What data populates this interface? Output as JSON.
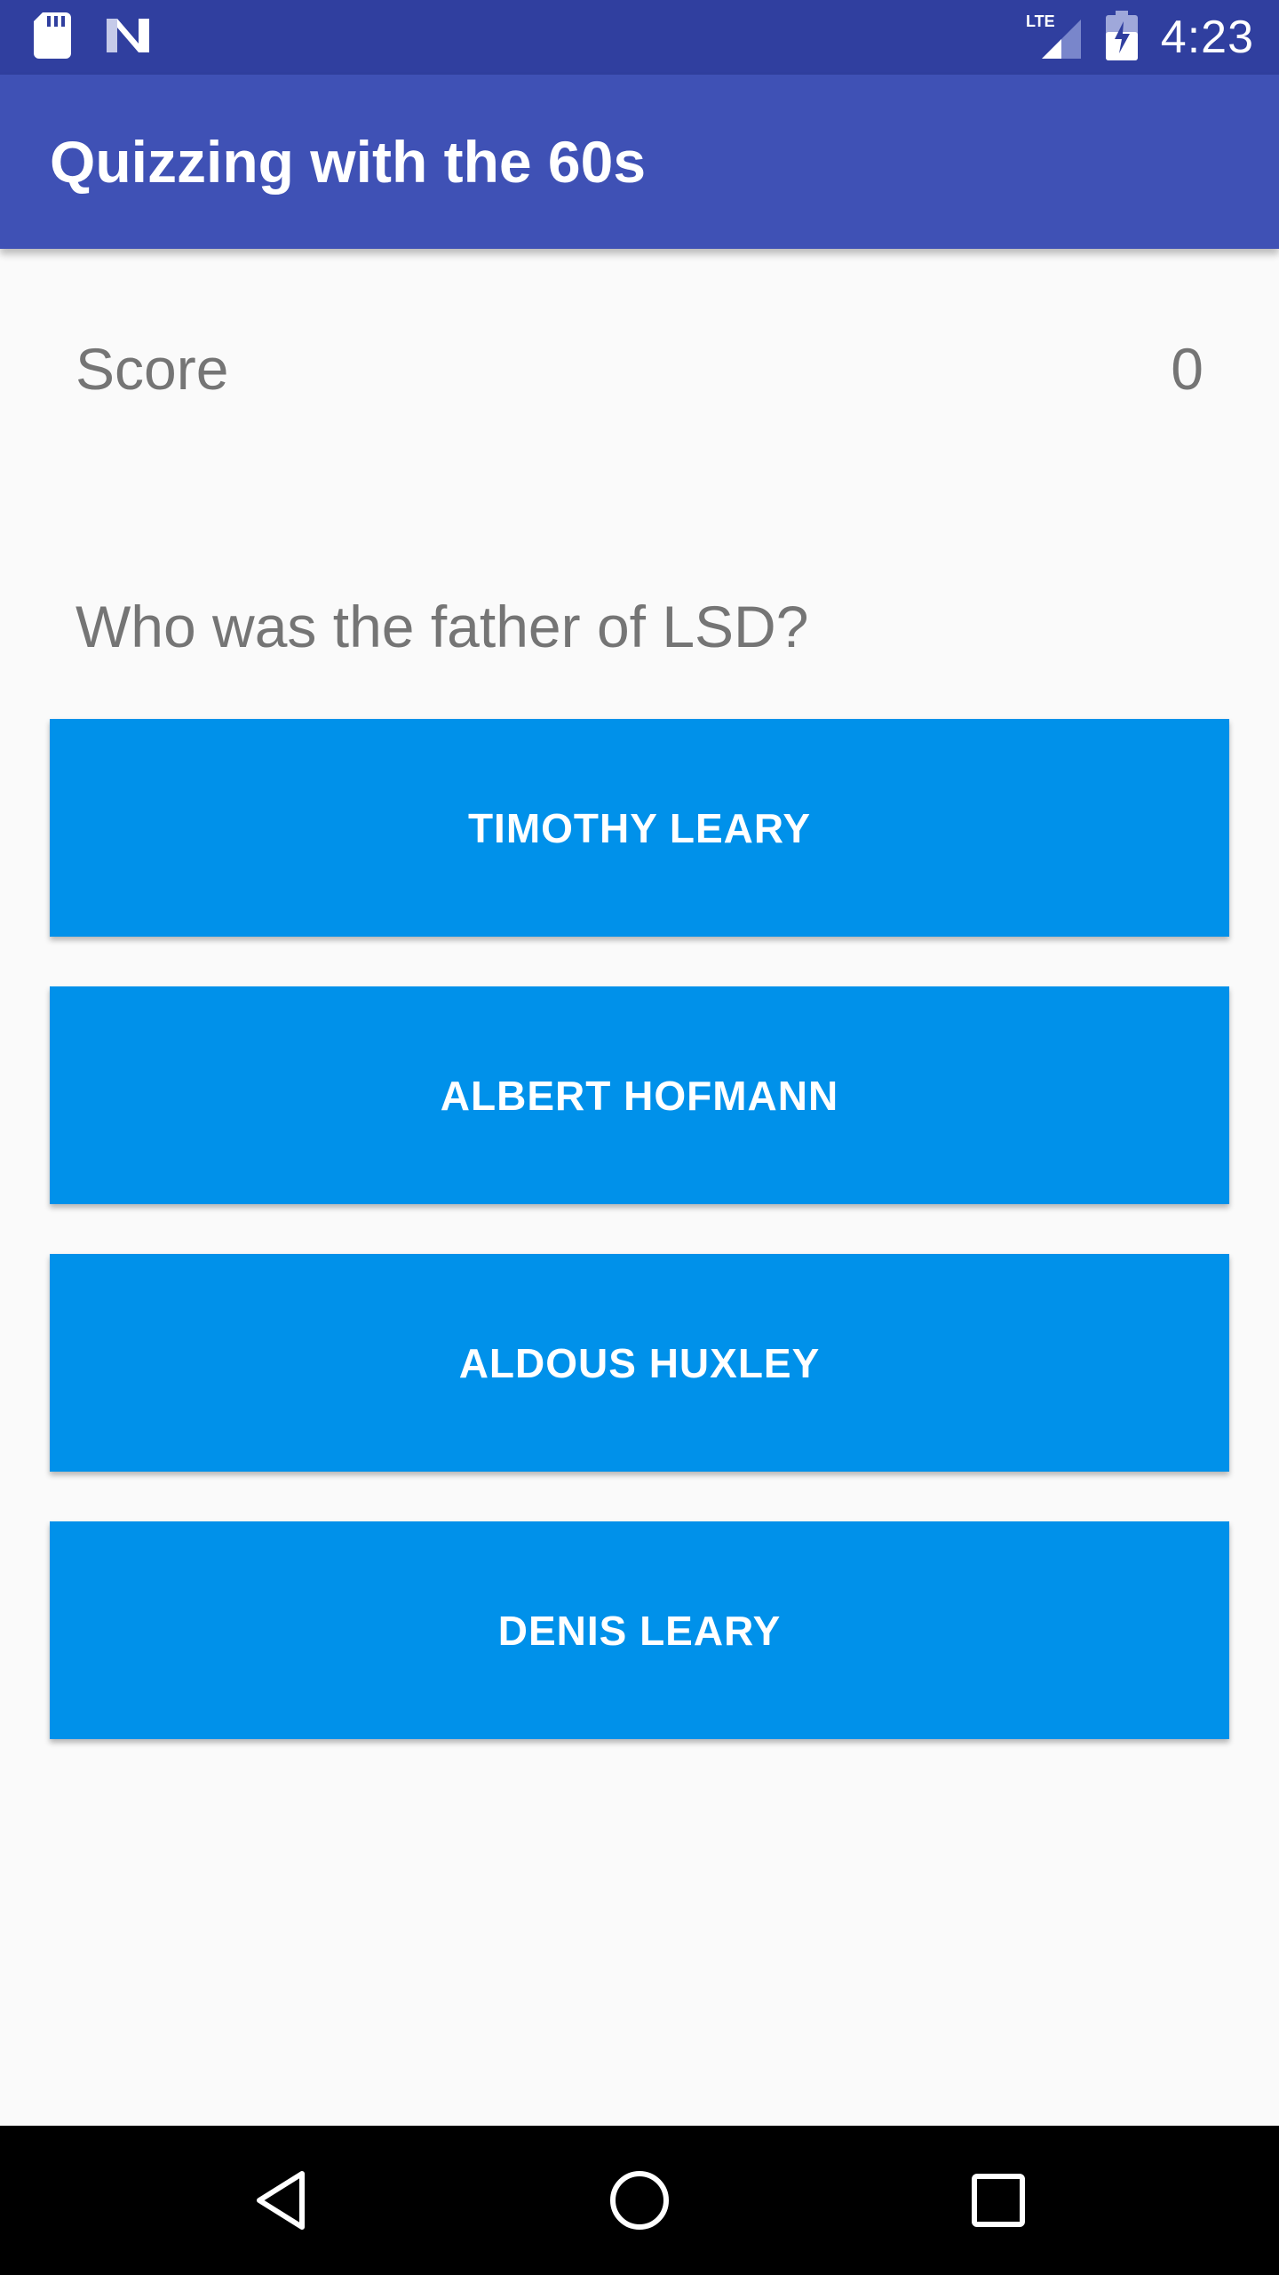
{
  "status_bar": {
    "time": "4:23",
    "network_label": "LTE",
    "icons": [
      "sd-card-icon",
      "n-logo-icon",
      "lte-signal-icon",
      "battery-charging-icon"
    ]
  },
  "app_bar": {
    "title": "Quizzing with the 60s"
  },
  "score": {
    "label": "Score",
    "value": "0"
  },
  "question": {
    "text": "Who was the father of LSD?"
  },
  "answers": [
    {
      "label": "TIMOTHY LEARY"
    },
    {
      "label": "ALBERT HOFMANN"
    },
    {
      "label": "ALDOUS HUXLEY"
    },
    {
      "label": "DENIS LEARY"
    }
  ],
  "navigation": {
    "icons": [
      "back-icon",
      "home-icon",
      "recents-icon"
    ]
  },
  "colors": {
    "status_bar": "#303f9f",
    "app_bar": "#3f51b5",
    "button": "#0091ea",
    "text_secondary": "#757575",
    "background": "#fafafa"
  }
}
